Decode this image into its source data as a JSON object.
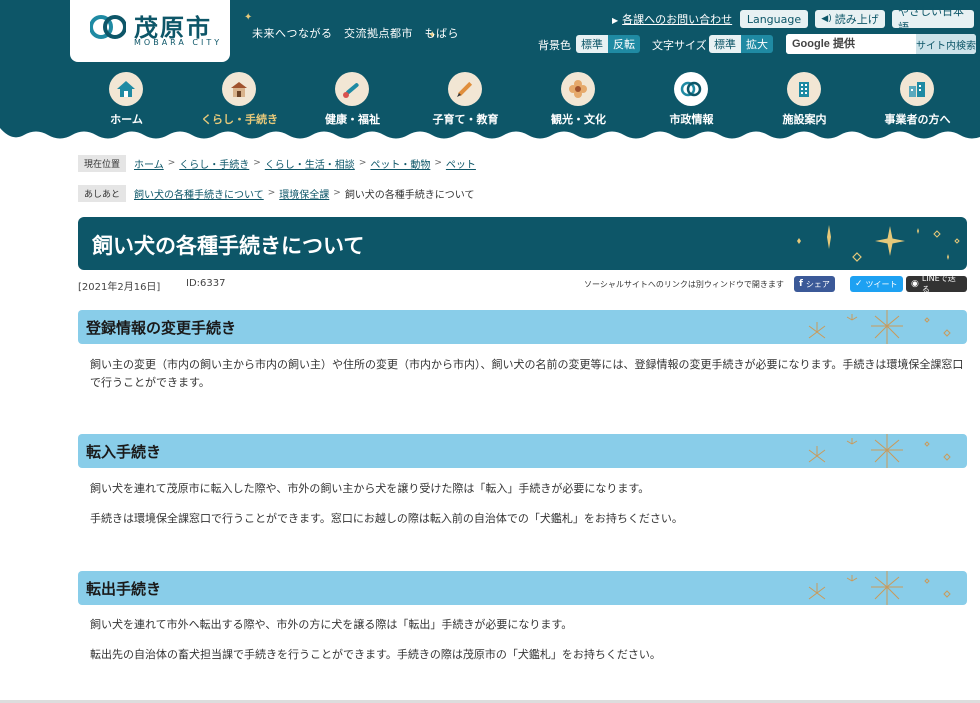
{
  "header": {
    "logo_text": "茂原市",
    "logo_sub": "MOBARA CITY",
    "slogan": "未来へつながる　交流拠点都市　もばら",
    "inquiry_link": "各課へのお問い合わせ",
    "language_btn": "Language",
    "read_aloud_btn": "読み上げ",
    "easy_japanese_btn": "やさしい日本語",
    "bg_color_label": "背景色",
    "bg_standard": "標準",
    "bg_invert": "反転",
    "font_size_label": "文字サイズ",
    "font_standard": "標準",
    "font_large": "拡大",
    "search_placeholder": "Google 提供",
    "search_button": "サイト内検索"
  },
  "nav": {
    "items": [
      {
        "label": "ホーム",
        "icon": "home-icon"
      },
      {
        "label": "くらし・手続き",
        "icon": "house-icon"
      },
      {
        "label": "健康・福祉",
        "icon": "thermometer-icon"
      },
      {
        "label": "子育て・教育",
        "icon": "pencil-icon"
      },
      {
        "label": "観光・文化",
        "icon": "flower-icon"
      },
      {
        "label": "市政情報",
        "icon": "city-emblem-icon"
      },
      {
        "label": "施設案内",
        "icon": "building-icon"
      },
      {
        "label": "事業者の方へ",
        "icon": "office-icon"
      }
    ]
  },
  "breadcrumb": {
    "label": "現在位置",
    "items": [
      "ホーム",
      "くらし・手続き",
      "くらし・生活・相談",
      "ペット・動物",
      "ペット"
    ]
  },
  "history": {
    "label": "あしあと",
    "items": [
      "飼い犬の各種手続きについて",
      "環境保全課"
    ],
    "current": "飼い犬の各種手続きについて"
  },
  "page": {
    "title": "飼い犬の各種手続きについて",
    "date": "[2021年2月16日]",
    "id": "ID:6337",
    "sns_note": "ソーシャルサイトへのリンクは別ウィンドウで開きます",
    "share_facebook": "シェア",
    "share_twitter": "ツイート",
    "share_line": "LINEで送る"
  },
  "sections": [
    {
      "heading": "登録情報の変更手続き",
      "paragraphs": [
        "飼い主の変更（市内の飼い主から市内の飼い主）や住所の変更（市内から市内）、飼い犬の名前の変更等には、登録情報の変更手続きが必要になります。手続きは環境保全課窓口で行うことができます。"
      ]
    },
    {
      "heading": "転入手続き",
      "paragraphs": [
        "飼い犬を連れて茂原市に転入した際や、市外の飼い主から犬を譲り受けた際は「転入」手続きが必要になります。",
        "手続きは環境保全課窓口で行うことができます。窓口にお越しの際は転入前の自治体での「犬鑑札」をお持ちください。"
      ]
    },
    {
      "heading": "転出手続き",
      "paragraphs": [
        "飼い犬を連れて市外へ転出する際や、市外の方に犬を譲る際は「転出」手続きが必要になります。",
        "転出先の自治体の畜犬担当課で手続きを行うことができます。手続きの際は茂原市の「犬鑑札」をお持ちください。"
      ]
    }
  ],
  "colors": {
    "header_bg": "#0d5668",
    "section_bg": "#89cde9",
    "accent_gold": "#e6c97a"
  }
}
